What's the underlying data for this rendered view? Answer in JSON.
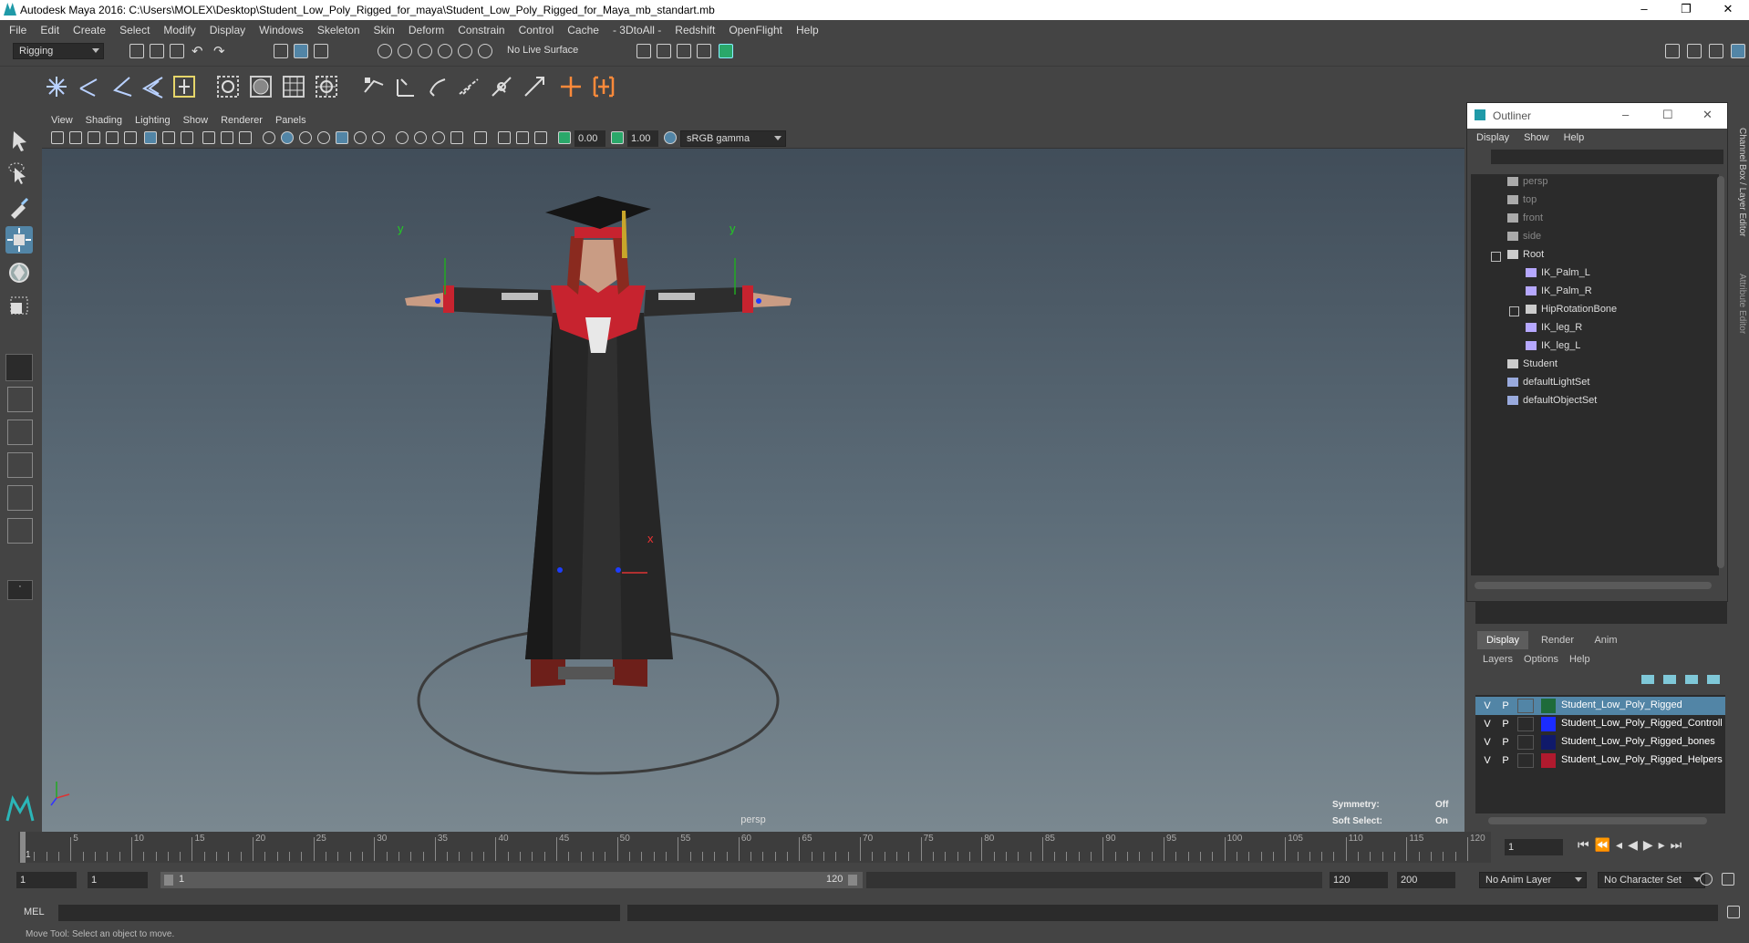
{
  "titlebar": {
    "title": "Autodesk Maya 2016: C:\\Users\\MOLEX\\Desktop\\Student_Low_Poly_Rigged_for_maya\\Student_Low_Poly_Rigged_for_Maya_mb_standart.mb",
    "minimize": "–",
    "restore": "❐",
    "close": "✕"
  },
  "menubar": [
    "File",
    "Edit",
    "Create",
    "Select",
    "Modify",
    "Display",
    "Windows",
    "Skeleton",
    "Skin",
    "Deform",
    "Constrain",
    "Control",
    "Cache",
    "- 3DtoAll -",
    "Redshift",
    "OpenFlight",
    "Help"
  ],
  "statusline": {
    "menuset": "Rigging",
    "live_surface": "No Live Surface"
  },
  "viewport": {
    "menu": [
      "View",
      "Shading",
      "Lighting",
      "Show",
      "Renderer",
      "Panels"
    ],
    "near_value": "0.00",
    "gamma_value": "1.00",
    "color_space": "sRGB gamma",
    "camera_label": "persp",
    "hud": {
      "symmetry_label": "Symmetry:",
      "symmetry_value": "Off",
      "soft_select_label": "Soft Select:",
      "soft_select_value": "On"
    },
    "axis_y": "y",
    "axis_x": "x"
  },
  "outliner": {
    "title": "Outliner",
    "menu": [
      "Display",
      "Show",
      "Help"
    ],
    "items": [
      {
        "label": "persp",
        "indent": 1,
        "dim": true,
        "icon": "camera-icon"
      },
      {
        "label": "top",
        "indent": 1,
        "dim": true,
        "icon": "camera-icon"
      },
      {
        "label": "front",
        "indent": 1,
        "dim": true,
        "icon": "camera-icon"
      },
      {
        "label": "side",
        "indent": 1,
        "dim": true,
        "icon": "camera-icon"
      },
      {
        "label": "Root",
        "indent": 1,
        "dim": false,
        "icon": "joint-icon"
      },
      {
        "label": "IK_Palm_L",
        "indent": 2,
        "dim": false,
        "icon": "ik-handle-icon"
      },
      {
        "label": "IK_Palm_R",
        "indent": 2,
        "dim": false,
        "icon": "ik-handle-icon"
      },
      {
        "label": "HipRotationBone",
        "indent": 2,
        "dim": false,
        "icon": "joint-icon"
      },
      {
        "label": "IK_leg_R",
        "indent": 2,
        "dim": false,
        "icon": "ik-handle-icon"
      },
      {
        "label": "IK_leg_L",
        "indent": 2,
        "dim": false,
        "icon": "ik-handle-icon"
      },
      {
        "label": "Student",
        "indent": 1,
        "dim": false,
        "icon": "transform-icon"
      },
      {
        "label": "defaultLightSet",
        "indent": 1,
        "dim": false,
        "icon": "set-icon"
      },
      {
        "label": "defaultObjectSet",
        "indent": 1,
        "dim": false,
        "icon": "set-icon"
      }
    ]
  },
  "layers": {
    "tabs": [
      "Display",
      "Render",
      "Anim"
    ],
    "menu": [
      "Layers",
      "Options",
      "Help"
    ],
    "rows": [
      {
        "v": "V",
        "p": "P",
        "name": "Student_Low_Poly_Rigged",
        "color": "#1e6b3a",
        "selected": true
      },
      {
        "v": "V",
        "p": "P",
        "name": "Student_Low_Poly_Rigged_Controll",
        "color": "#1b2cff",
        "selected": false
      },
      {
        "v": "V",
        "p": "P",
        "name": "Student_Low_Poly_Rigged_bones",
        "color": "#101a6a",
        "selected": false
      },
      {
        "v": "V",
        "p": "P",
        "name": "Student_Low_Poly_Rigged_Helpers",
        "color": "#b01a2e",
        "selected": false
      }
    ]
  },
  "sidetabs": [
    "Channel Box / Layer Editor",
    "Attribute Editor"
  ],
  "timeline": {
    "ticks": [
      "5",
      "10",
      "15",
      "20",
      "25",
      "30",
      "35",
      "40",
      "45",
      "50",
      "55",
      "60",
      "65",
      "70",
      "75",
      "80",
      "85",
      "90",
      "95",
      "100",
      "105",
      "110",
      "115",
      "120"
    ],
    "start_marker": "1",
    "current_frame": "1"
  },
  "range": {
    "start": "1",
    "playback_start": "1",
    "slider_start": "1",
    "slider_end": "120",
    "playback_end": "120",
    "end": "200",
    "anim_layer": "No Anim Layer",
    "character_set": "No Character Set"
  },
  "cmdline": {
    "label": "MEL"
  },
  "helpline": {
    "text": "Move Tool: Select an object to move."
  }
}
